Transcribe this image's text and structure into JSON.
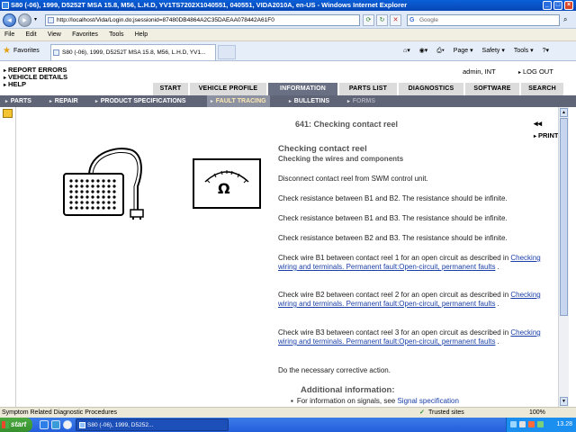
{
  "window": {
    "title": "S80 (-06), 1999, D5252T MSA 15.8, M56, L.H.D, YV1TS7202X1040551, 040551, VIDA2010A, en-US - Windows Internet Explorer",
    "min": "_",
    "max": "□",
    "close": "×"
  },
  "browser": {
    "url": "http://localhost/Vida/Login.do;jsessionid=87480DB4864A2C35DAEAA078442A61F0",
    "search_placeholder": "Google",
    "menu": [
      "File",
      "Edit",
      "View",
      "Favorites",
      "Tools",
      "Help"
    ],
    "favorites_label": "Favorites",
    "tab_title": "S80 (-06), 1999, D5252T MSA 15.8, M56, L.H.D, YV1...",
    "commands": [
      "Page ▾",
      "Safety ▾",
      "Tools ▾"
    ]
  },
  "vida": {
    "top_links": [
      "REPORT ERRORS",
      "VEHICLE DETAILS",
      "HELP"
    ],
    "user": "admin, INT",
    "logout": "LOG OUT",
    "tabs": [
      "START",
      "VEHICLE PROFILE",
      "INFORMATION",
      "PARTS LIST",
      "DIAGNOSTICS",
      "SOFTWARE",
      "SEARCH"
    ],
    "active_tab": "INFORMATION",
    "subnav": [
      "PARTS",
      "REPAIR",
      "PRODUCT SPECIFICATIONS",
      "FAULT TRACING",
      "BULLETINS",
      "FORMS"
    ],
    "active_sub": "FAULT TRACING",
    "disabled_sub": "FORMS"
  },
  "doc": {
    "title": "641: Checking contact reel",
    "nav": "◂◂",
    "print": "PRINT",
    "heading": "Checking contact reel",
    "subheading": "Checking the wires and components",
    "p1": "Disconnect contact reel from SWM control unit.",
    "p2": "Check resistance between B1 and B2. The resistance should be infinite.",
    "p3": "Check resistance between B1 and B3. The resistance should be infinite.",
    "p4": "Check resistance between B2 and B3. The resistance should be infinite.",
    "p5_text": "Check wire B1 between contact reel 1 for an open circuit as described in",
    "p6_text": "Check wire B2 between contact reel 2 for an open circuit as described in",
    "p7_text": "Check wire B3 between contact reel 3 for an open circuit as described in",
    "link_text": "Checking wiring and terminals. Permanent fault:Open-circuit, permanent faults",
    "link_suffix": " .",
    "p8": "Do the necessary corrective action.",
    "additional": "Additional information:",
    "bullet_text": "For information on signals, see ",
    "bullet_link": "Signal specification",
    "ohm_symbol": "Ω"
  },
  "status": {
    "text": "Symptom Related Diagnostic Procedures",
    "trusted": "Trusted sites",
    "zoom": "100%"
  },
  "taskbar": {
    "start": "start",
    "item": "S80 (-06), 1999, D5252...",
    "clock": "13.28"
  }
}
